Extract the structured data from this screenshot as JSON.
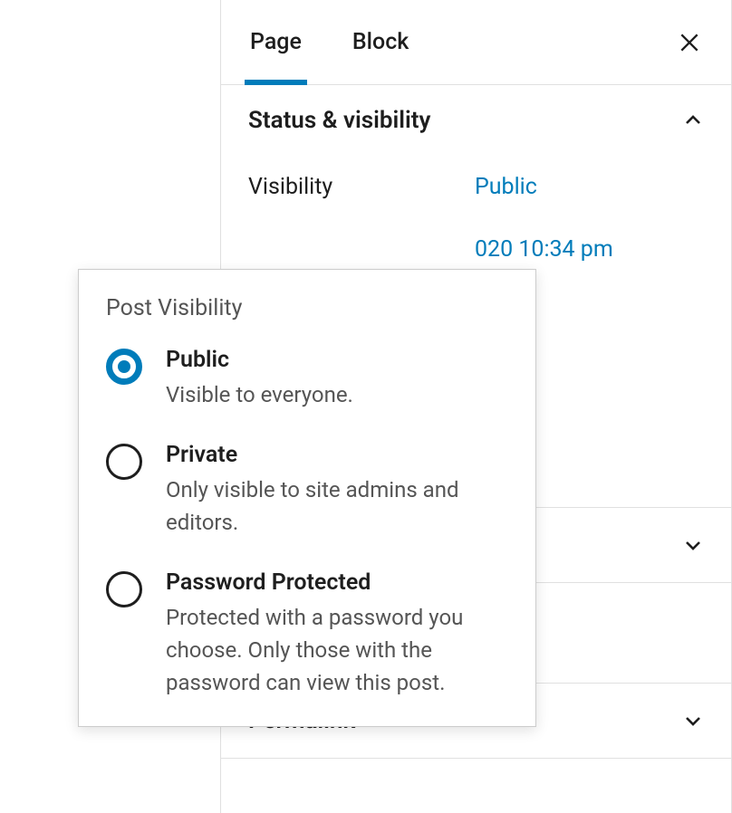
{
  "tabs": {
    "page": "Page",
    "block": "Block"
  },
  "panels": {
    "status": {
      "title": "Status & visibility",
      "visibility_label": "Visibility",
      "visibility_value": "Public",
      "publish_value_fragment": "020 10:34 pm"
    },
    "permalink": {
      "title": "Permalink"
    }
  },
  "popover": {
    "title": "Post Visibility",
    "options": [
      {
        "label": "Public",
        "desc": "Visible to everyone.",
        "selected": true
      },
      {
        "label": "Private",
        "desc": "Only visible to site admins and editors.",
        "selected": false
      },
      {
        "label": "Password Protected",
        "desc": "Protected with a password you choose. Only those with the password can view this post.",
        "selected": false
      }
    ]
  }
}
